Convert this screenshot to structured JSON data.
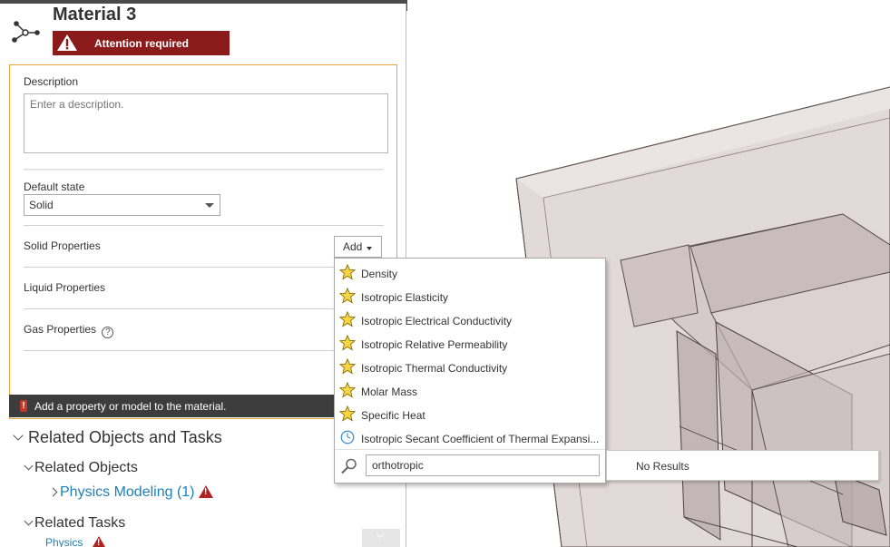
{
  "material": {
    "title": "Material 3",
    "icon": "node-graph-icon",
    "attention": "Attention required"
  },
  "form": {
    "description_label": "Description",
    "description_placeholder": "Enter a description.",
    "default_state_label": "Default state",
    "default_state_value": "Solid",
    "solid_properties_label": "Solid Properties",
    "add_label": "Add",
    "liquid_properties_label": "Liquid Properties",
    "gas_properties_label": "Gas Properties",
    "help_glyph": "?",
    "hint": "Add a property or model to the material."
  },
  "dropdown": {
    "items": [
      {
        "label": "Density",
        "icon": "star-icon"
      },
      {
        "label": "Isotropic Elasticity",
        "icon": "star-icon"
      },
      {
        "label": "Isotropic Electrical Conductivity",
        "icon": "star-icon"
      },
      {
        "label": "Isotropic Relative Permeability",
        "icon": "star-icon"
      },
      {
        "label": "Isotropic Thermal Conductivity",
        "icon": "star-icon"
      },
      {
        "label": "Molar Mass",
        "icon": "star-icon"
      },
      {
        "label": "Specific Heat",
        "icon": "star-icon"
      },
      {
        "label": "Isotropic Secant Coefficient of Thermal Expansi...",
        "icon": "clock-icon"
      }
    ],
    "search_value": "orthotropic",
    "results_text": "No Results"
  },
  "related": {
    "header": "Related Objects and Tasks",
    "objects_label": "Related Objects",
    "physics_link": "Physics Modeling (1)",
    "tasks_label": "Related Tasks",
    "physics_task": "Physics"
  },
  "colors": {
    "attention_bg": "#8b1a1a",
    "card_border": "#e8a33d",
    "link": "#1f7fb8",
    "star": "#f5d547"
  }
}
